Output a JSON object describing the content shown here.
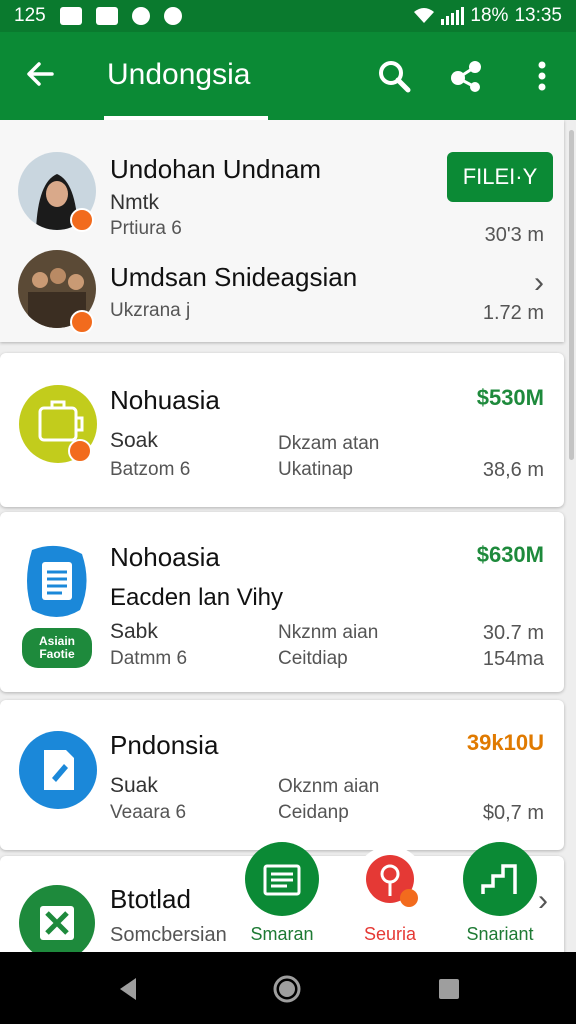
{
  "status_bar": {
    "time_left": "125",
    "battery": "18%",
    "time_right": "13:35"
  },
  "app_bar": {
    "title": "Undongsia",
    "back_icon": "arrow-back-icon",
    "search_icon": "search-icon",
    "share_icon": "share-icon",
    "more_icon": "more-vert-icon"
  },
  "top_card": {
    "filter_label": "FILEI·Y",
    "items": [
      {
        "name": "Undohan Undnam",
        "line1": "Nmtk",
        "line2": "Prtiura 6",
        "right": "30'3 m"
      },
      {
        "name": "Umdsan Snideagsian",
        "line1": "Ukzrana j",
        "right": "1.72 m"
      }
    ]
  },
  "cards": [
    {
      "name": "Nohuasia",
      "price": "$530M",
      "left1": "Soak",
      "left2": "Batzom 6",
      "mid1": "Dkzam atan",
      "mid2": "Ukatinap",
      "right2": "38,6 m"
    },
    {
      "name": "Nohoasia",
      "price": "$630M",
      "subtitle": "Eacden lan Vihy",
      "badge": "Asiain Faotie",
      "left1": "Sabk",
      "left2": "Datmm 6",
      "mid1": "Nkznm aian",
      "mid2": "Ceitdiap",
      "right1": "30.7 m",
      "right2": "154ma"
    },
    {
      "name": "Pndonsia",
      "price": "39k10U",
      "left1": "Suak",
      "left2": "Veaara 6",
      "mid1": "Okznm aian",
      "mid2": "Ceidanp",
      "right2": "$0,7 m"
    },
    {
      "name": "Btotlad",
      "left1": "Somcbersian"
    }
  ],
  "fabs": [
    {
      "label": "Smaran",
      "icon": "list-icon",
      "color": "#0b8a35"
    },
    {
      "label": "Seuria",
      "icon": "location-pin-icon",
      "color": "#e53935"
    },
    {
      "label": "Snariant",
      "icon": "chart-icon",
      "color": "#0b8a35"
    }
  ],
  "colors": {
    "primary": "#0b8a35",
    "status": "#0a7a2e",
    "price_green": "#1e8a3c",
    "price_orange": "#e07a00",
    "badge_orange": "#f26b1d"
  }
}
